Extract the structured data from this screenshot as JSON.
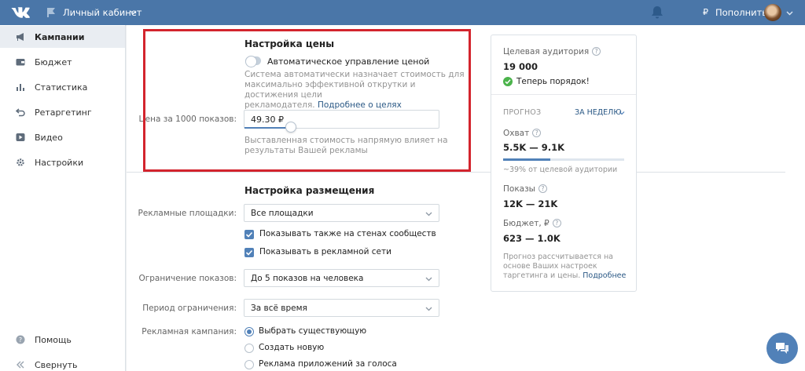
{
  "topbar": {
    "cabinet_label": "Личный кабинет",
    "currency_symbol": "₽",
    "topup_label": "Пополнить"
  },
  "sidebar": {
    "items": [
      {
        "label": "Кампании",
        "icon": "megaphone-icon",
        "active": true
      },
      {
        "label": "Бюджет",
        "icon": "wallet-icon"
      },
      {
        "label": "Статистика",
        "icon": "bar-chart-icon"
      },
      {
        "label": "Ретаргетинг",
        "icon": "retarget-icon"
      },
      {
        "label": "Видео",
        "icon": "play-icon"
      },
      {
        "label": "Настройки",
        "icon": "gear-icon"
      }
    ],
    "help_label": "Помощь",
    "collapse_label": "Свернуть"
  },
  "price": {
    "title": "Настройка цены",
    "auto_label": "Автоматическое управление ценой",
    "auto_enabled": false,
    "auto_hint": "Система автоматически назначает стоимость для максимально эффективной открутки и достижения цели рекламодателя.",
    "auto_hint_line1": "Система автоматически назначает стоимость для",
    "auto_hint_line2": "максимально эффективной открутки и достижения цели",
    "auto_hint_line3": "рекламодателя.",
    "more_link": "Подробнее о целях",
    "price_label": "Цена за 1000 показов:",
    "price_value": "49.30 ₽",
    "slider_fraction": 0.23,
    "price_hint_line1": "Выставленная стоимость напрямую влияет на",
    "price_hint_line2": "результаты Вашей рекламы"
  },
  "placement": {
    "title": "Настройка размещения",
    "platforms_label": "Рекламные площадки:",
    "platforms_value": "Все площадки",
    "walls_label": "Показывать также на стенах сообществ",
    "walls_checked": true,
    "network_label": "Показывать в рекламной сети",
    "network_checked": true,
    "limit_label": "Ограничение показов:",
    "limit_value": "До 5 показов на человека",
    "period_label": "Период ограничения:",
    "period_value": "За всё время",
    "campaign_label": "Рекламная кампания:",
    "campaign_options": [
      "Выбрать существующую",
      "Создать новую",
      "Реклама приложений за голоса"
    ],
    "campaign_selected": 0
  },
  "stats": {
    "audience_label": "Целевая аудитория",
    "audience_value": "19 000",
    "status": "Теперь порядок!",
    "forecast_label": "ПРОГНОЗ",
    "period": "ЗА НЕДЕЛЮ",
    "reach_label": "Охват",
    "reach_value": "5.5K — 9.1K",
    "reach_fraction": 0.39,
    "reach_note": "~39% от целевой аудитории",
    "impressions_label": "Показы",
    "impressions_value": "12K — 21K",
    "budget_label": "Бюджет, ₽",
    "budget_value": "623 — 1.0K",
    "note_line1": "Прогноз рассчитывается на",
    "note_line2": "основе Ваших настроек",
    "note_line3": "таргетинга и цены.",
    "note_link": "Подробнее"
  },
  "colors": {
    "header": "#4a76a8",
    "accent": "#5181b8",
    "highlight_border": "#d3242d",
    "success": "#4bb34b"
  }
}
